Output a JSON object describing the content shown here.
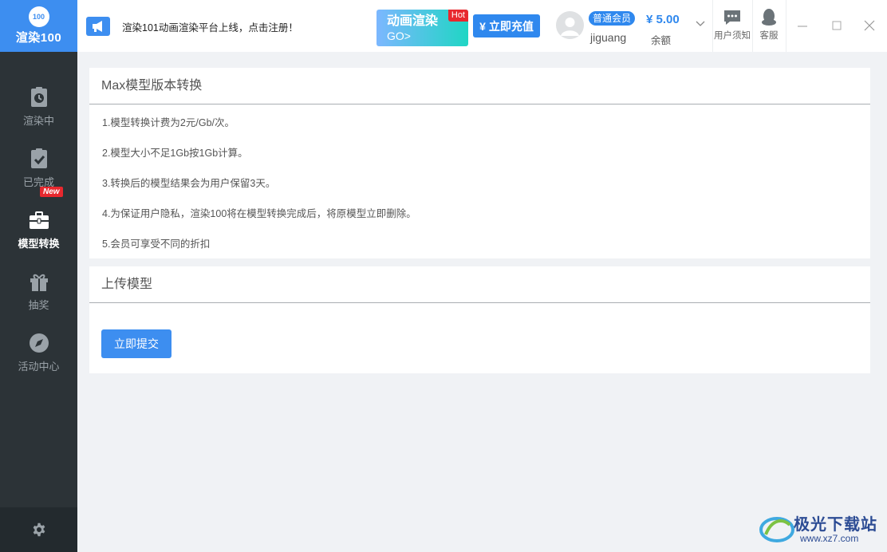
{
  "logo": {
    "badge": "100",
    "name": "渲染100"
  },
  "sidebar": {
    "items": [
      {
        "label": "渲染中",
        "icon": "clock-icon",
        "active": false
      },
      {
        "label": "已完成",
        "icon": "clipboard-check-icon",
        "active": false
      },
      {
        "label": "模型转换",
        "icon": "toolbox-icon",
        "active": true
      },
      {
        "label": "抽奖",
        "icon": "gift-icon",
        "active": false,
        "badge": "New"
      },
      {
        "label": "活动中心",
        "icon": "compass-icon",
        "active": false
      }
    ],
    "settings_icon": "gear-icon"
  },
  "header": {
    "announcement": "渲染101动画渲染平台上线，点击注册！",
    "promo": {
      "title": "动画渲染",
      "subtitle": "GO>",
      "badge": "Hot"
    },
    "recharge_label": "¥ 立即充值",
    "member_badge": "普通会员",
    "username": "jiguang",
    "balance": "¥ 5.00",
    "balance_label": "余额",
    "notice_label": "用户须知",
    "service_label": "客服"
  },
  "conversion": {
    "title": "Max模型版本转换",
    "rules": [
      "1.模型转换计费为2元/Gb/次。",
      "2.模型大小不足1Gb按1Gb计算。",
      "3.转换后的模型结果会为用户保留3天。",
      "4.为保证用户隐私，渲染100将在模型转换完成后，将原模型立即删除。",
      "5.会员可享受不同的折扣"
    ]
  },
  "upload": {
    "title": "上传模型",
    "submit_label": "立即提交"
  },
  "watermark": {
    "name": "极光下载站",
    "url": "www.xz7.com"
  },
  "colors": {
    "accent": "#3d8ef0",
    "sidebar_bg": "#2c3337",
    "hot": "#e8282e"
  }
}
